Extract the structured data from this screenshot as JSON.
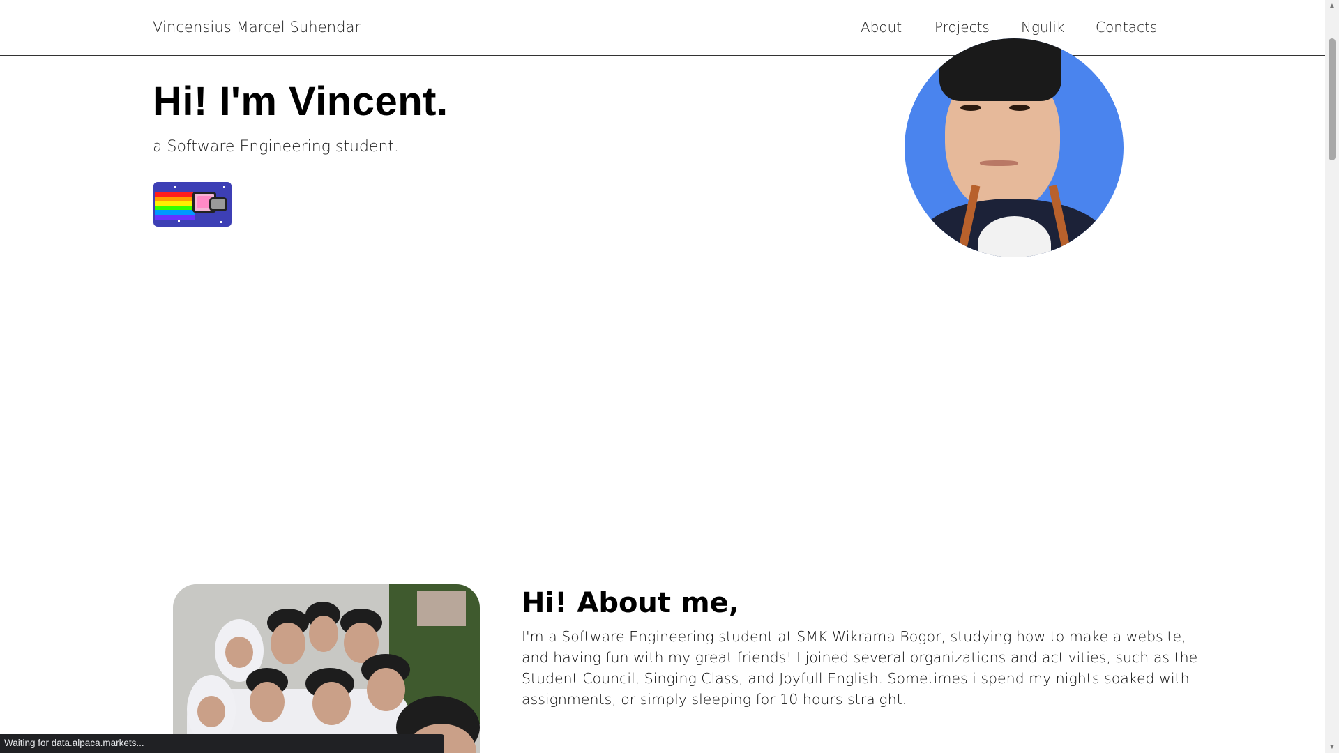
{
  "header": {
    "brand": "Vincensius Marcel Suhendar",
    "nav": [
      {
        "label": "About"
      },
      {
        "label": "Projects"
      },
      {
        "label": "Ngulik"
      },
      {
        "label": "Contacts"
      }
    ]
  },
  "hero": {
    "title": "Hi! I'm Vincent.",
    "subtitle": "a Software Engineering student.",
    "nyan_image": "nyan-cat",
    "avatar_image": "profile-photo",
    "avatar_bg_color": "#4a84ee"
  },
  "about": {
    "title": "Hi! About me,",
    "text": "I'm a Software Engineering student at SMK Wikrama Bogor, studying how to make a website, and having fun with my great friends! I joined several organizations and activities, such as the Student Council, Singing Class, and Joyfull English. Sometimes i spend my nights soaked with assignments, or simply sleeping for 10 hours straight.",
    "photo_image": "group-photo"
  },
  "status": {
    "text": "Waiting for data.alpaca.markets..."
  },
  "icons": {
    "scroll_up": "▲",
    "scroll_down": "▼"
  }
}
